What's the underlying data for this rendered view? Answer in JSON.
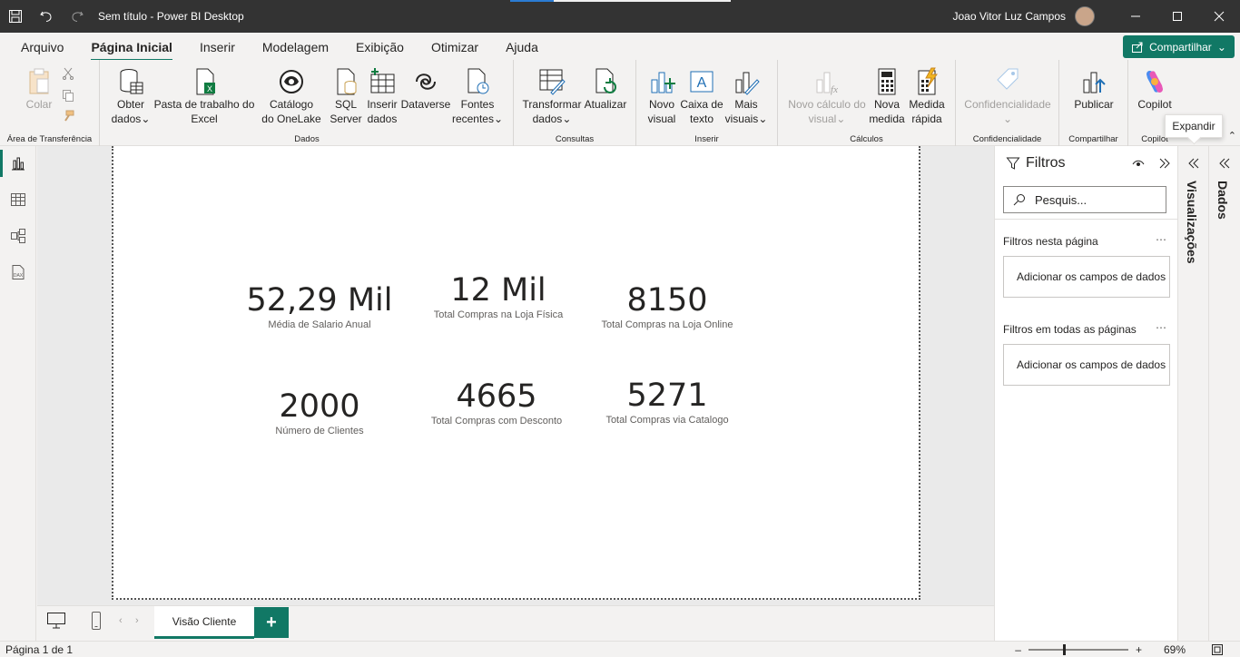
{
  "app": {
    "title": "Sem título - Power BI Desktop",
    "user": "Joao Vitor Luz Campos"
  },
  "menu": {
    "tabs": [
      "Arquivo",
      "Página Inicial",
      "Inserir",
      "Modelagem",
      "Exibição",
      "Otimizar",
      "Ajuda"
    ],
    "active": "Página Inicial",
    "share_label": "Compartilhar"
  },
  "ribbon": {
    "clipboard": {
      "label": "Área de Transferência",
      "paste": "Colar"
    },
    "data": {
      "label": "Dados",
      "get_data": [
        "Obter",
        "dados"
      ],
      "excel": [
        "Pasta de trabalho do",
        "Excel"
      ],
      "onelake": [
        "Catálogo",
        "do OneLake"
      ],
      "sql": [
        "SQL",
        "Server"
      ],
      "enter_data": [
        "Inserir",
        "dados"
      ],
      "dataverse": "Dataverse",
      "recent": [
        "Fontes",
        "recentes"
      ]
    },
    "queries": {
      "label": "Consultas",
      "transform": [
        "Transformar",
        "dados"
      ],
      "refresh": "Atualizar"
    },
    "insert": {
      "label": "Inserir",
      "new_visual": [
        "Novo",
        "visual"
      ],
      "text_box": [
        "Caixa de",
        "texto"
      ],
      "more_visuals": [
        "Mais",
        "visuais"
      ]
    },
    "calculations": {
      "label": "Cálculos",
      "visual_calc": [
        "Novo cálculo do",
        "visual"
      ],
      "new_measure": [
        "Nova",
        "medida"
      ],
      "quick_measure": [
        "Medida",
        "rápida"
      ]
    },
    "sensitivity": {
      "label": "Confidencialidade",
      "button": "Confidencialidade"
    },
    "share": {
      "label": "Compartilhar",
      "publish": "Publicar"
    },
    "copilot": {
      "label": "Copilot",
      "button": "Copilot"
    }
  },
  "cards": [
    {
      "value": "52,29 Mil",
      "label": "Média de Salario Anual"
    },
    {
      "value": "12 Mil",
      "label": "Total Compras na Loja Física"
    },
    {
      "value": "8150",
      "label": "Total Compras na Loja Online"
    },
    {
      "value": "2000",
      "label": "Número de Clientes"
    },
    {
      "value": "4665",
      "label": "Total Compras com Desconto"
    },
    {
      "value": "5271",
      "label": "Total Compras via Catalogo"
    }
  ],
  "filters": {
    "title": "Filtros",
    "search_placeholder": "Pesquis...",
    "page_section": "Filtros nesta página",
    "all_section": "Filtros em todas as páginas",
    "drop_hint": "Adicionar os campos de dados aqui"
  },
  "panes": {
    "visualizations": "Visualizações",
    "data": "Dados",
    "tooltip": "Expandir"
  },
  "pages": {
    "tab": "Visão Cliente",
    "status": "Página 1 de 1",
    "zoom": "69%"
  }
}
